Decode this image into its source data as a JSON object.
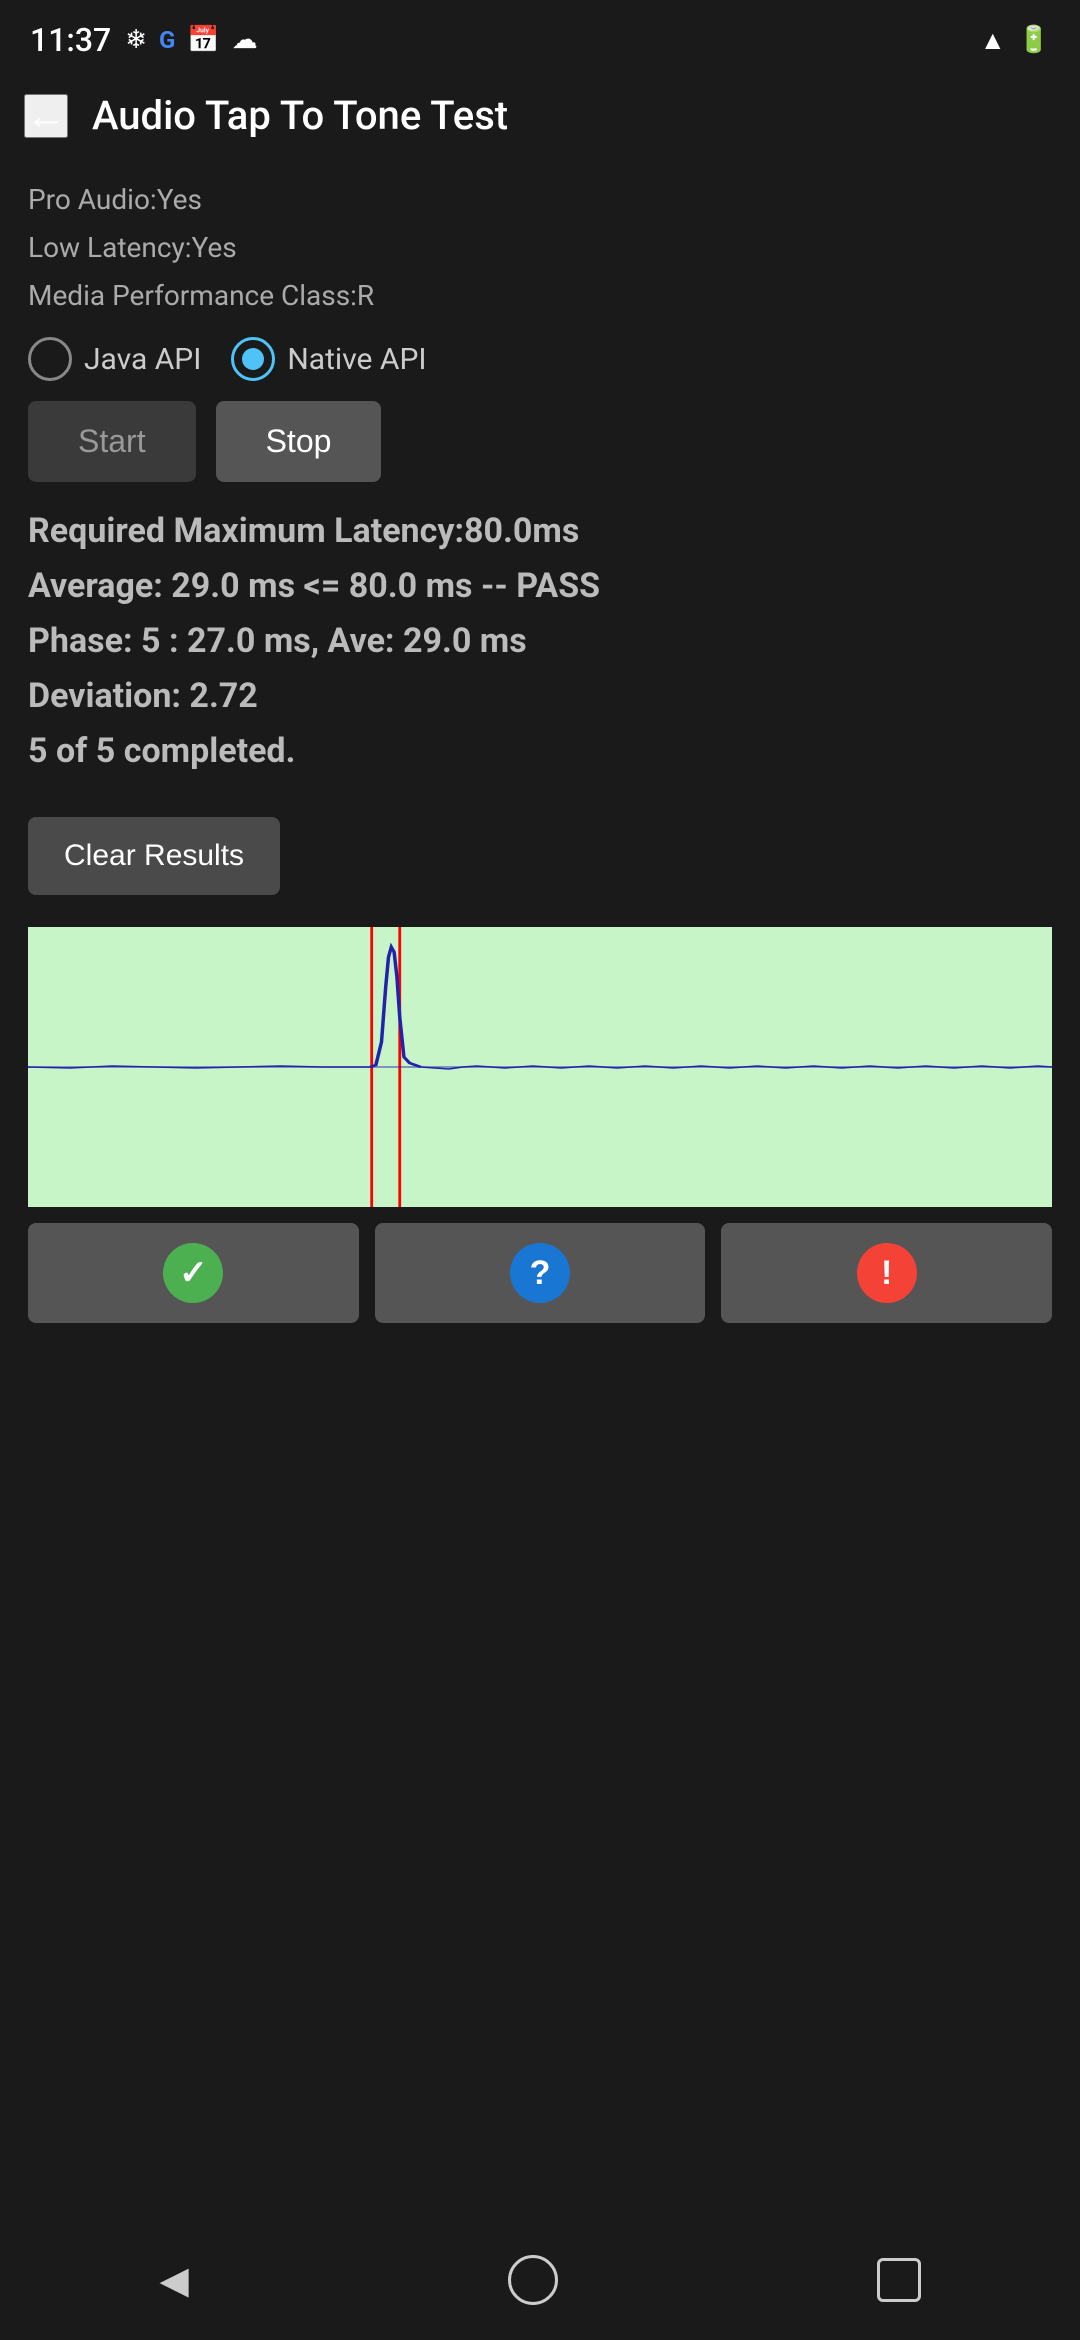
{
  "statusBar": {
    "time": "11:37",
    "leftIcons": [
      "fan-icon",
      "google-icon",
      "calendar-icon",
      "cloud-icon"
    ],
    "rightIcons": [
      "wifi-icon",
      "battery-icon"
    ]
  },
  "appBar": {
    "backLabel": "←",
    "title": "Audio Tap To Tone Test"
  },
  "info": {
    "proAudio": "Pro Audio:Yes",
    "lowLatency": "Low Latency:Yes",
    "mediaPerformance": "Media Performance Class:R"
  },
  "radioGroup": {
    "options": [
      "Java API",
      "Native API"
    ],
    "selected": 1
  },
  "buttons": {
    "start": "Start",
    "stop": "Stop"
  },
  "results": {
    "line1": "Required Maximum Latency:80.0ms",
    "line2": "Average: 29.0 ms <= 80.0 ms -- PASS",
    "line3": "Phase: 5 : 27.0 ms, Ave: 29.0 ms",
    "line4": "Deviation: 2.72",
    "line5": "5 of 5 completed."
  },
  "clearButton": "Clear Results",
  "bottomButtons": {
    "pass": "✓",
    "question": "?",
    "warning": "!"
  },
  "navBar": {
    "back": "◀",
    "home": "",
    "recent": ""
  }
}
